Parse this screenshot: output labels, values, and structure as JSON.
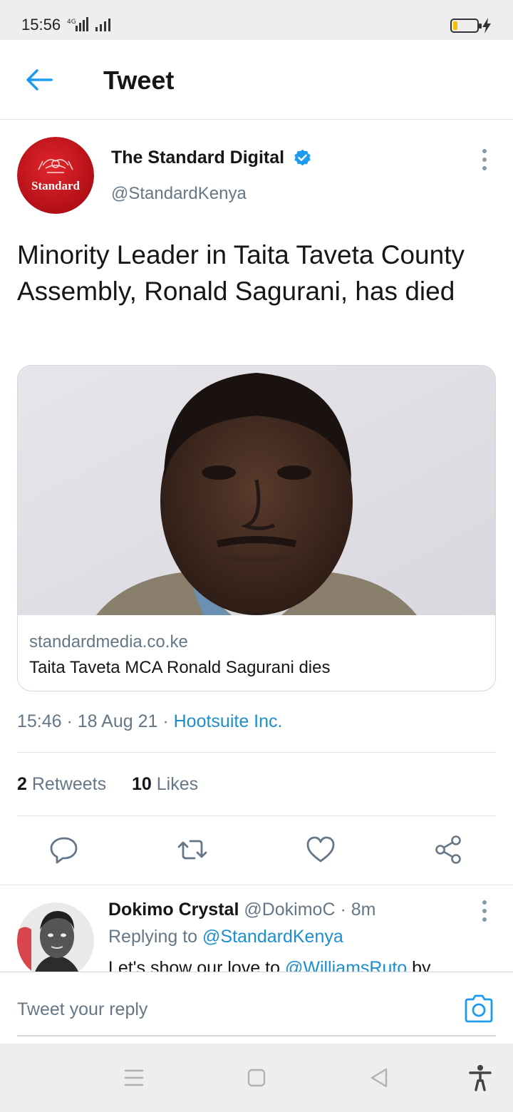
{
  "status_bar": {
    "time": "15:56",
    "network": "4G",
    "battery_level_percent": 20,
    "battery_color": "#f2c200"
  },
  "header": {
    "back_icon": "arrow-left-icon",
    "title": "Tweet"
  },
  "tweet": {
    "author_name": "The Standard Digital",
    "author_handle": "@StandardKenya",
    "avatar_text": "Standard",
    "verified": true,
    "text": "Minority Leader in Taita Taveta County Assembly, Ronald Sagurani, has died",
    "card": {
      "domain": "standardmedia.co.ke",
      "title": "Taita Taveta MCA Ronald Sagurani dies"
    },
    "timestamp": "15:46 · 18 Aug 21 · ",
    "source": "Hootsuite Inc.",
    "retweets_count": "2",
    "retweets_label": "Retweets",
    "likes_count": "10",
    "likes_label": "Likes",
    "actions": [
      "reply-icon",
      "retweet-icon",
      "like-icon",
      "share-icon"
    ]
  },
  "reply": {
    "author_name": "Dokimo Crystal",
    "meta": " @DokimoC · 8m",
    "replying_label": "Replying to ",
    "replying_handle": "@StandardKenya",
    "text_start": "Let's show our love to ",
    "text_mention": "@WilliamsRuto",
    "text_end": " by"
  },
  "composer": {
    "placeholder": "Tweet your reply"
  },
  "colors": {
    "accent": "#1d9bf0",
    "link": "#1d8ecf",
    "secondary_text": "#657786",
    "brand_red": "#c8161d"
  }
}
